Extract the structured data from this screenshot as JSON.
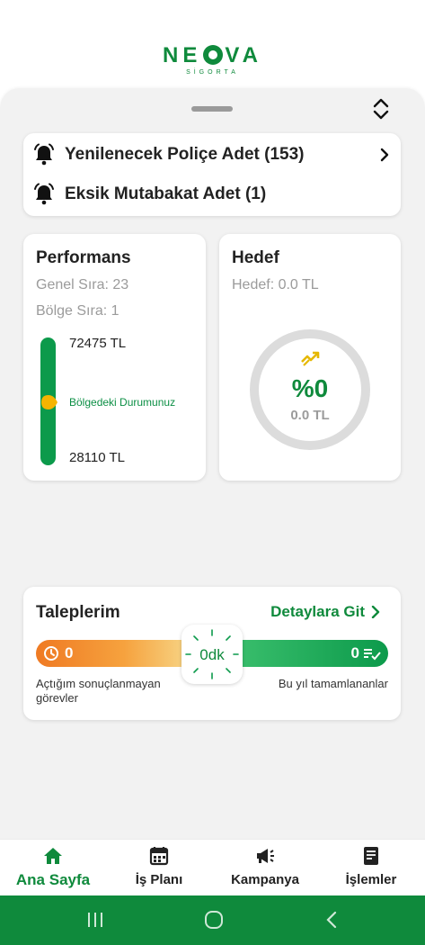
{
  "brand": {
    "name_prefix": "NE",
    "name_suffix": "VA",
    "sub": "SİGORTA",
    "color": "#0f8a3c"
  },
  "notifications": [
    {
      "label": "Yenilenecek Poliçe Adet (153)",
      "icon": "bell-alert-icon",
      "has_chevron": true
    },
    {
      "label": "Eksik Mutabakat Adet (1)",
      "icon": "bell-alert-icon",
      "has_chevron": false
    }
  ],
  "performance": {
    "title": "Performans",
    "general_rank": "Genel Sıra: 23",
    "region_rank": "Bölge Sıra: 1",
    "max_label": "72475 TL",
    "marker_label": "Bölgedeki Durumunuz",
    "min_label": "28110 TL"
  },
  "target": {
    "title": "Hedef",
    "subtitle": "Hedef: 0.0 TL",
    "percent": "%0",
    "amount": "0.0 TL",
    "progress": 0
  },
  "requests": {
    "title": "Taleplerim",
    "link": "Detaylara Git",
    "open_count": "0",
    "done_count": "0",
    "timer": "0dk",
    "open_desc": "Açtığım sonuçlanmayan görevler",
    "done_desc": "Bu yıl tamamlananlar"
  },
  "nav": [
    {
      "label": "Ana Sayfa",
      "icon": "home-icon",
      "active": true
    },
    {
      "label": "İş Planı",
      "icon": "calendar-icon",
      "active": false
    },
    {
      "label": "Kampanya",
      "icon": "megaphone-icon",
      "active": false
    },
    {
      "label": "İşlemler",
      "icon": "document-icon",
      "active": false
    }
  ],
  "colors": {
    "primary": "#0f8a3c",
    "orange": "#ef7a23",
    "marker": "#f5b400"
  }
}
